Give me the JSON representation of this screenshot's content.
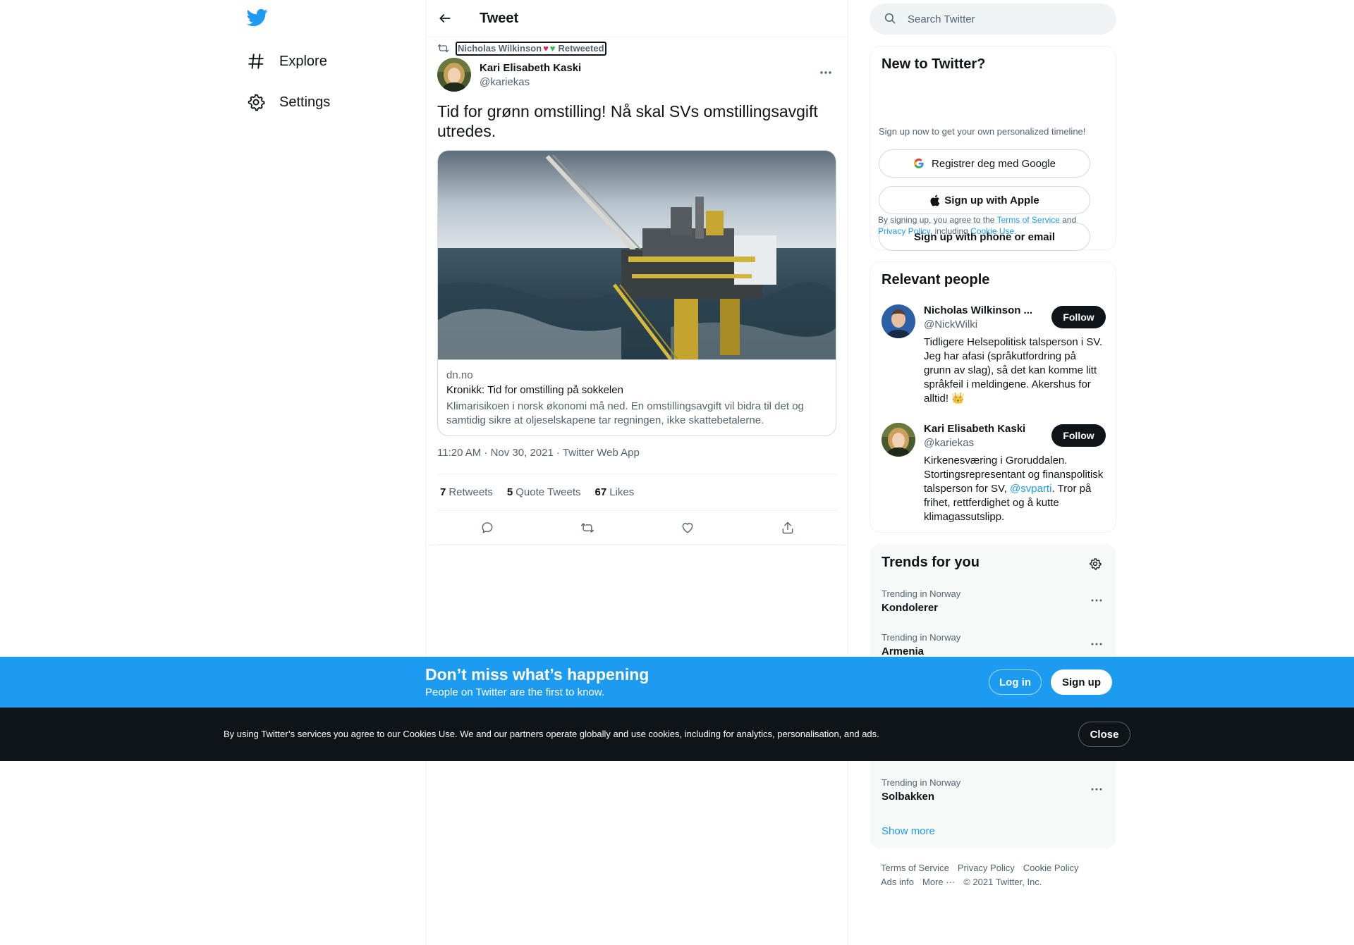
{
  "nav": {
    "logo_icon": "twitter-bird-icon",
    "items": [
      {
        "label": "Explore",
        "icon": "hashtag-icon"
      },
      {
        "label": "Settings",
        "icon": "gear-icon"
      }
    ]
  },
  "header": {
    "title": "Tweet"
  },
  "tweet": {
    "retweeted_by": "Nicholas Wilkinson",
    "retweeted_suffix": "Retweeted",
    "author_name": "Kari Elisabeth Kaski",
    "author_handle": "@kariekas",
    "text": "Tid for grønn omstilling! Nå skal SVs omstillingsavgift utredes.",
    "card": {
      "domain": "dn.no",
      "title": "Kronikk: Tid for omstilling på sokkelen",
      "description": "Klimarisikoen i norsk økonomi må ned. En omstillingsavgift vil bidra til det og samtidig sikre at oljeselskapene tar regningen, ikke skattebetalerne."
    },
    "meta": "11:20 AM · Nov 30, 2021 · Twitter Web App",
    "stats": {
      "retweets_count": "7",
      "retweets_label": "Retweets",
      "quotes_count": "5",
      "quotes_label": "Quote Tweets",
      "likes_count": "67",
      "likes_label": "Likes"
    }
  },
  "search": {
    "placeholder": "Search Twitter"
  },
  "new_to_twitter": {
    "title": "New to Twitter?",
    "subtitle": "Sign up now to get your own personalized timeline!",
    "google_label": "Registrer deg med Google",
    "apple_label": "Sign up with Apple",
    "phone_label": "Sign up with phone or email",
    "legal_prefix": "By signing up, you agree to the ",
    "legal_tos": "Terms of Service",
    "legal_and": " and ",
    "legal_privacy": "Privacy Policy",
    "legal_including": ", including ",
    "legal_cookie": "Cookie Use",
    "legal_end": "."
  },
  "relevant_people": {
    "title": "Relevant people",
    "people": [
      {
        "name": "Nicholas Wilkinson ...",
        "handle": "@NickWilki",
        "bio": "Tidligere Helsepolitisk talsperson i SV. Jeg har afasi (språkutfordring på grunn av slag), så det kan komme litt språkfeil i meldingene. Akershus for alltid! 👑",
        "follow_label": "Follow"
      },
      {
        "name": "Kari Elisabeth Kaski",
        "handle": "@kariekas",
        "bio_before": "Kirkenesværing i Groruddalen. Stortingsrepresentant og finanspolitisk talsperson for SV, ",
        "bio_link": "@svparti",
        "bio_after": ". Tror på frihet, rettferdighet og å kutte klimagassutslipp.",
        "follow_label": "Follow"
      }
    ]
  },
  "trends": {
    "title": "Trends for you",
    "items": [
      {
        "meta": "Trending in Norway",
        "name": "Kondolerer"
      },
      {
        "meta": "Trending in Norway",
        "name": "Armenia"
      },
      {
        "meta": "Trending in Norway",
        "name": "Solbakken"
      }
    ],
    "show_more": "Show more"
  },
  "footer": {
    "links": [
      "Terms of Service",
      "Privacy Policy",
      "Cookie Policy",
      "Ads info",
      "More ···",
      "© 2021 Twitter, Inc."
    ]
  },
  "bottom_bar": {
    "title": "Don’t miss what’s happening",
    "subtitle": "People on Twitter are the first to know.",
    "login_label": "Log in",
    "signup_label": "Sign up"
  },
  "cookie_bar": {
    "text": "By using Twitter’s services you agree to our Cookies Use. We and our partners operate globally and use cookies, including for analytics, personalisation, and ads.",
    "close_label": "Close"
  },
  "colors": {
    "accent": "#1d9bf0",
    "text": "#0f1419",
    "muted": "#536471",
    "cookie_bg": "#0f1419"
  }
}
